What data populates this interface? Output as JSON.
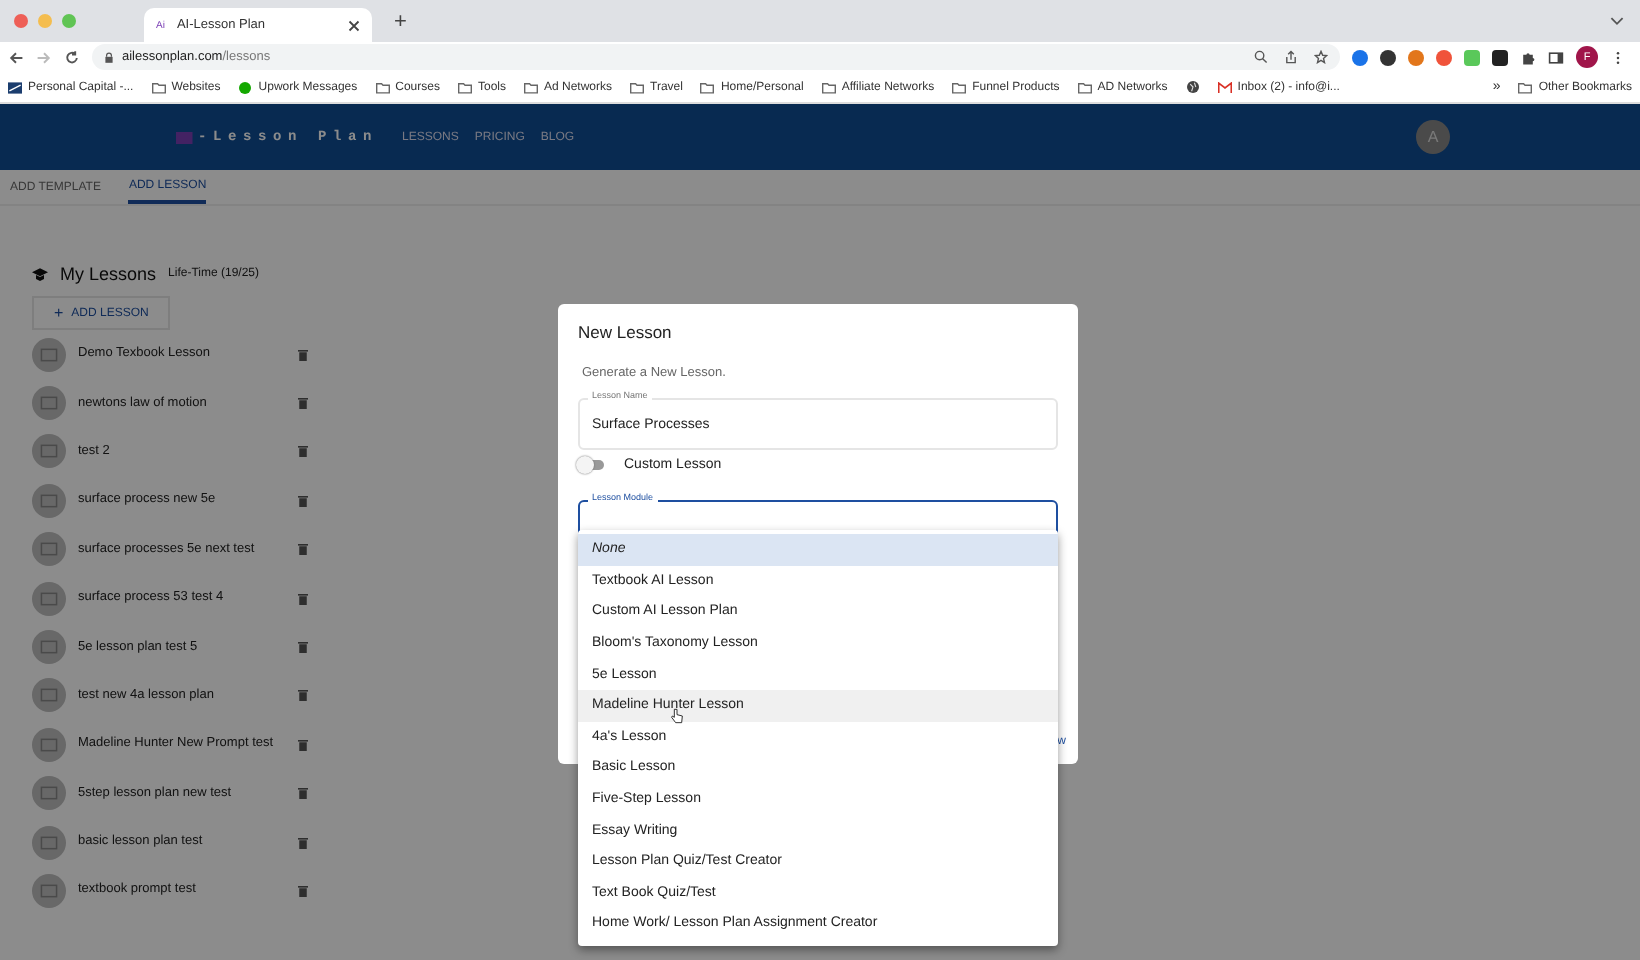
{
  "browser": {
    "tab_title": "AI-Lesson Plan",
    "tab_favicon": "Ai",
    "new_tab": "+",
    "url_host": "ailessonplan.com",
    "url_path": "/lessons",
    "bookmarks": [
      {
        "kind": "site",
        "label": "Personal Capital -..."
      },
      {
        "kind": "folder",
        "label": "Websites"
      },
      {
        "kind": "upwork",
        "label": "Upwork Messages"
      },
      {
        "kind": "folder",
        "label": "Courses"
      },
      {
        "kind": "folder",
        "label": "Tools"
      },
      {
        "kind": "folder",
        "label": "Ad Networks"
      },
      {
        "kind": "folder",
        "label": "Travel"
      },
      {
        "kind": "folder",
        "label": "Home/Personal"
      },
      {
        "kind": "folder",
        "label": "Affiliate Networks"
      },
      {
        "kind": "folder",
        "label": "Funnel Products"
      },
      {
        "kind": "folder",
        "label": "AD Networks"
      },
      {
        "kind": "globe"
      },
      {
        "kind": "mail",
        "label": "Inbox (2) - info@i..."
      }
    ],
    "overflow": "»",
    "other_bookmarks": "Other Bookmarks",
    "profile": "F"
  },
  "app": {
    "logo": "-Lesson Plan",
    "nav": [
      "LESSONS",
      "PRICING",
      "BLOG"
    ],
    "avatar": "A"
  },
  "subtabs": [
    {
      "label": "ADD TEMPLATE",
      "selected": false
    },
    {
      "label": "ADD LESSON",
      "selected": true
    }
  ],
  "sidebar": {
    "title": "My Lessons",
    "quota": "Life-Time (19/25)",
    "add_button": "ADD LESSON",
    "add_icon": "+",
    "lessons": [
      "Demo Texbook Lesson",
      "newtons law of motion",
      "test 2",
      "surface process new 5e",
      "surface processes 5e next test",
      "surface process 53 test 4",
      "5e lesson plan test 5",
      "test new 4a lesson plan",
      "Madeline Hunter New Prompt test",
      "5step lesson plan new test",
      "basic lesson plan test",
      "textbook prompt test"
    ]
  },
  "dialog": {
    "title": "New Lesson",
    "subtitle": "Generate a New Lesson.",
    "lesson_name": {
      "label": "Lesson Name",
      "value": "Surface Processes"
    },
    "custom_lesson": {
      "label": "Custom Lesson",
      "on": false
    },
    "module": {
      "label": "Lesson Module"
    },
    "link_fragment": "w",
    "options": [
      {
        "label": "None",
        "selected": true,
        "hovered": false
      },
      {
        "label": "Textbook AI Lesson",
        "selected": false,
        "hovered": false
      },
      {
        "label": "Custom AI Lesson Plan",
        "selected": false,
        "hovered": false
      },
      {
        "label": "Bloom's Taxonomy Lesson",
        "selected": false,
        "hovered": false
      },
      {
        "label": "5e Lesson",
        "selected": false,
        "hovered": false
      },
      {
        "label": "Madeline Hunter Lesson",
        "selected": false,
        "hovered": true
      },
      {
        "label": "4a's Lesson",
        "selected": false,
        "hovered": false
      },
      {
        "label": "Basic Lesson",
        "selected": false,
        "hovered": false
      },
      {
        "label": "Five-Step Lesson",
        "selected": false,
        "hovered": false
      },
      {
        "label": "Essay Writing",
        "selected": false,
        "hovered": false
      },
      {
        "label": "Lesson Plan Quiz/Test Creator",
        "selected": false,
        "hovered": false
      },
      {
        "label": "Text Book Quiz/Test",
        "selected": false,
        "hovered": false
      },
      {
        "label": "Home Work/ Lesson Plan Assignment Creator",
        "selected": false,
        "hovered": false
      }
    ]
  }
}
